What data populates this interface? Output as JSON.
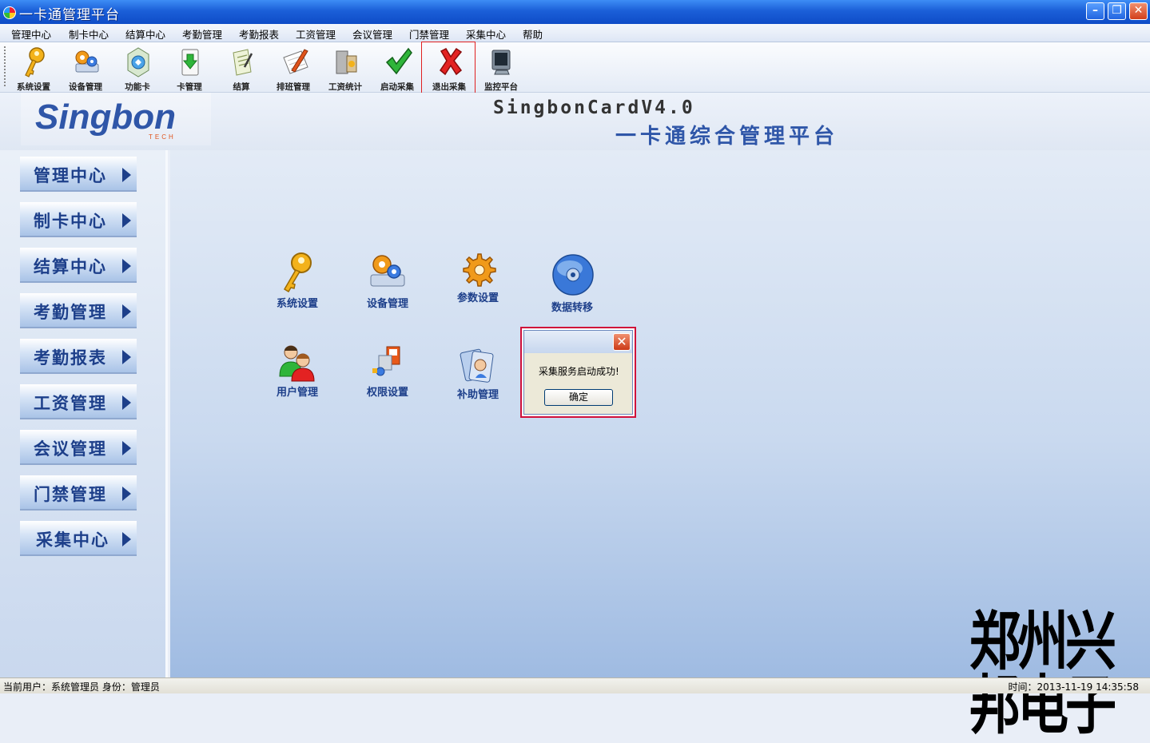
{
  "window": {
    "title": "一卡通管理平台"
  },
  "menu": [
    "管理中心",
    "制卡中心",
    "结算中心",
    "考勤管理",
    "考勤报表",
    "工资管理",
    "会议管理",
    "门禁管理",
    "采集中心",
    "帮助"
  ],
  "toolbar": [
    "系统设置",
    "设备管理",
    "功能卡",
    "卡管理",
    "结算",
    "排班管理",
    "工资统计",
    "启动采集",
    "退出采集",
    "监控平台"
  ],
  "banner": {
    "logo": "Singbon",
    "logo_sub": "TECH",
    "product": "SingbonCardV4.0",
    "platform": "一卡通综合管理平台"
  },
  "sidebar": [
    "管理中心",
    "制卡中心",
    "结算中心",
    "考勤管理",
    "考勤报表",
    "工资管理",
    "会议管理",
    "门禁管理",
    "采集中心"
  ],
  "main_icons": [
    "系统设置",
    "设备管理",
    "参数设置",
    "数据转移",
    "用户管理",
    "权限设置",
    "补助管理"
  ],
  "dialog": {
    "message": "采集服务启动成功!",
    "ok": "确定"
  },
  "watermark": "郑州兴邦电子",
  "status": {
    "left": "当前用户：系统管理员  身份：管理员",
    "right": "时间：2013-11-19 14:35:58"
  }
}
